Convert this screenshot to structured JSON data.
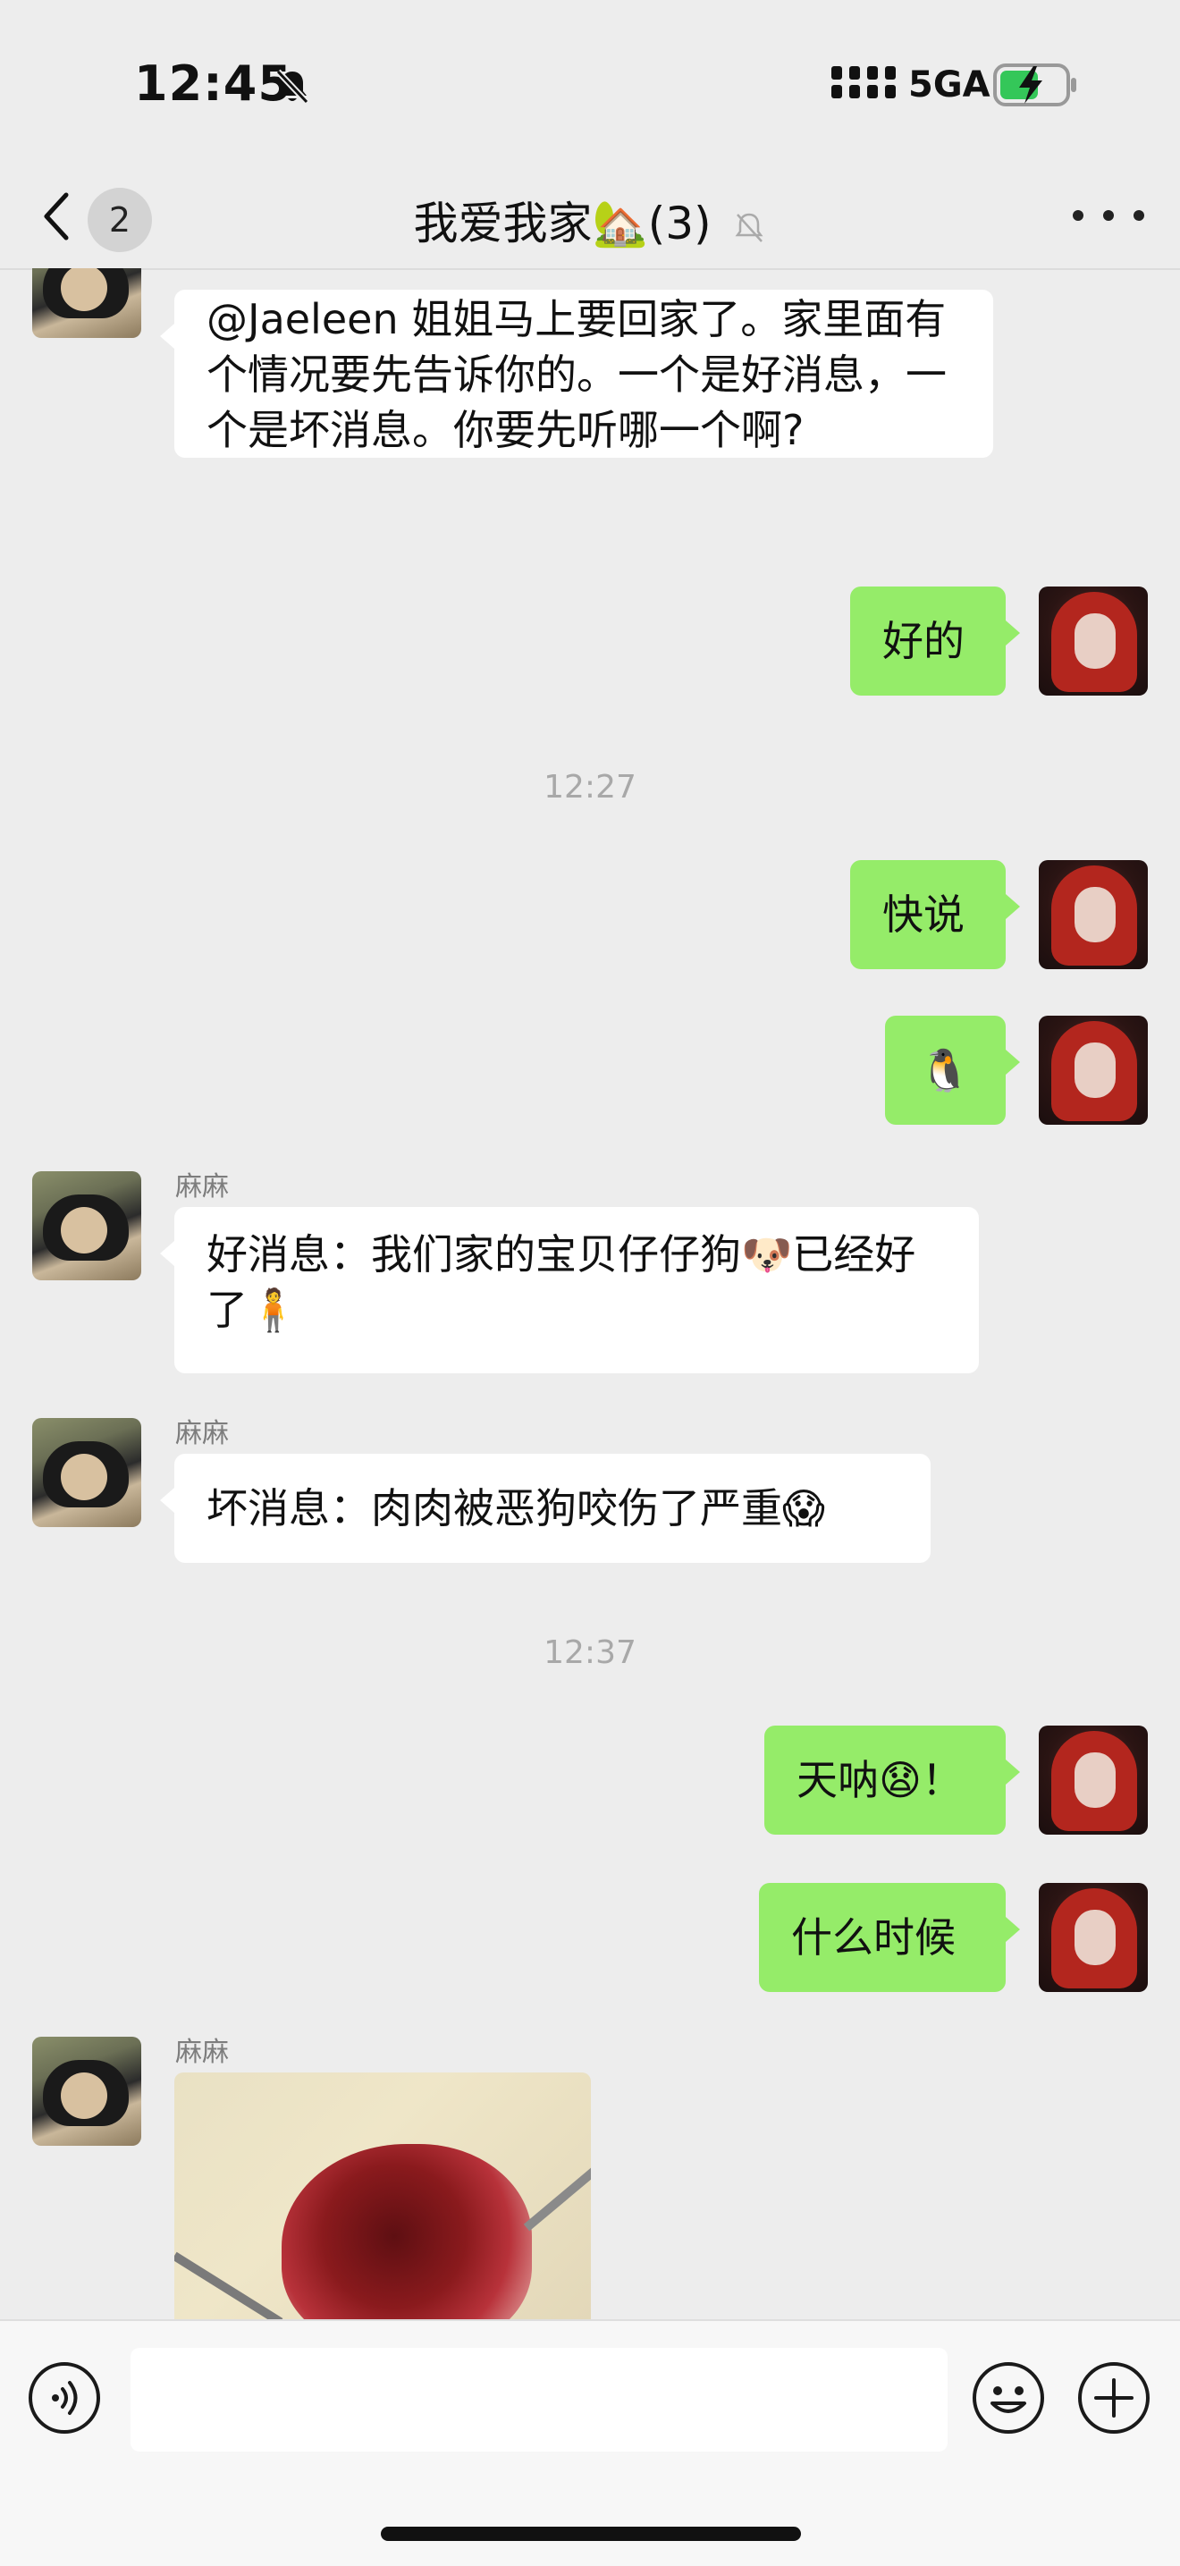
{
  "status_bar": {
    "time": "12:45",
    "network": "5GA",
    "battery_state": "charging"
  },
  "nav": {
    "back_badge": "2",
    "title": "我爱我家🏡(3)",
    "icons": {
      "back": "chevron-left-icon",
      "muted": "bell-off-icon",
      "more": "more-dots-icon"
    }
  },
  "messages": [
    {
      "side": "in",
      "sender": "",
      "text": "@Jaeleen 姐姐马上要回家了。家里面有个情况要先告诉你的。一个是好消息，一个是坏消息。你要先听哪一个啊?"
    },
    {
      "side": "out",
      "text": "好的"
    },
    {
      "side": "out",
      "text": "快说"
    },
    {
      "side": "out",
      "text": "🐧"
    },
    {
      "side": "in",
      "sender": "麻麻",
      "text": "好消息：我们家的宝贝仔仔狗🐶已经好了🧍"
    },
    {
      "side": "in",
      "sender": "麻麻",
      "text": "坏消息：肉肉被恶狗咬伤了严重😱"
    },
    {
      "side": "out",
      "text": "天呐😧！"
    },
    {
      "side": "out",
      "text": "什么时候"
    },
    {
      "side": "in",
      "sender": "麻麻",
      "type": "image"
    }
  ],
  "timestamps": [
    "12:27",
    "12:37"
  ],
  "input_bar": {
    "placeholder": "",
    "icons": {
      "voice": "voice-icon",
      "emoji": "emoji-icon",
      "plus": "plus-icon"
    }
  },
  "colors": {
    "background": "#ededed",
    "outgoing_bubble": "#95ec69",
    "incoming_bubble": "#ffffff",
    "timestamp": "#a8a8a8"
  }
}
